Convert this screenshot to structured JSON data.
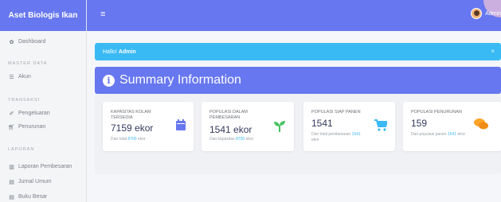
{
  "brand": "Aset Biologis Ikan",
  "topbar": {
    "menu_icon": "≡",
    "user_name": "Admin"
  },
  "sidebar": {
    "dashboard": "Dashboard",
    "sections": [
      {
        "title": "MASTER DATA",
        "items": [
          "Akun"
        ]
      },
      {
        "title": "TRANSAKSI",
        "items": [
          "Pengeluaran",
          "Penurunan"
        ]
      },
      {
        "title": "LAPORAN",
        "items": [
          "Laporan Pembesaran",
          "Jurnal Umum",
          "Buku Besar"
        ]
      }
    ]
  },
  "alert": {
    "greeting": "Hallo!",
    "name": "Admin",
    "close": "×"
  },
  "summary": {
    "title": "Summary Information"
  },
  "cards": [
    {
      "title_line1": "KAPASITAS KOLAM",
      "title_line2": "TERSEDIA",
      "value": "7159 ekor",
      "sub_prefix": "Dari total",
      "sub_link": "8700",
      "sub_suffix": "ekor",
      "icon": "calendar-icon",
      "color": "#6777ef"
    },
    {
      "title_line1": "POPULASI DALAM",
      "title_line2": "PEMBESARAN",
      "value": "1541 ekor",
      "sub_prefix": "Dari kapasitas",
      "sub_link": "8700",
      "sub_suffix": "ekor",
      "icon": "sprout-icon",
      "color": "#47c363"
    },
    {
      "title_line1": "POPULASI SIAP PANEN",
      "title_line2": "",
      "value": "1541",
      "sub_prefix": "Dari total pembesaran",
      "sub_link": "1541",
      "sub_suffix": "ekor",
      "icon": "cart-icon",
      "color": "#3abaf4"
    },
    {
      "title_line1": "POPULASI PENURUNAN",
      "title_line2": "",
      "value": "159",
      "sub_prefix": "Dari populasi panen",
      "sub_link": "1541",
      "sub_suffix": "ekor",
      "icon": "chat-icon",
      "color": "#ffa426"
    }
  ]
}
